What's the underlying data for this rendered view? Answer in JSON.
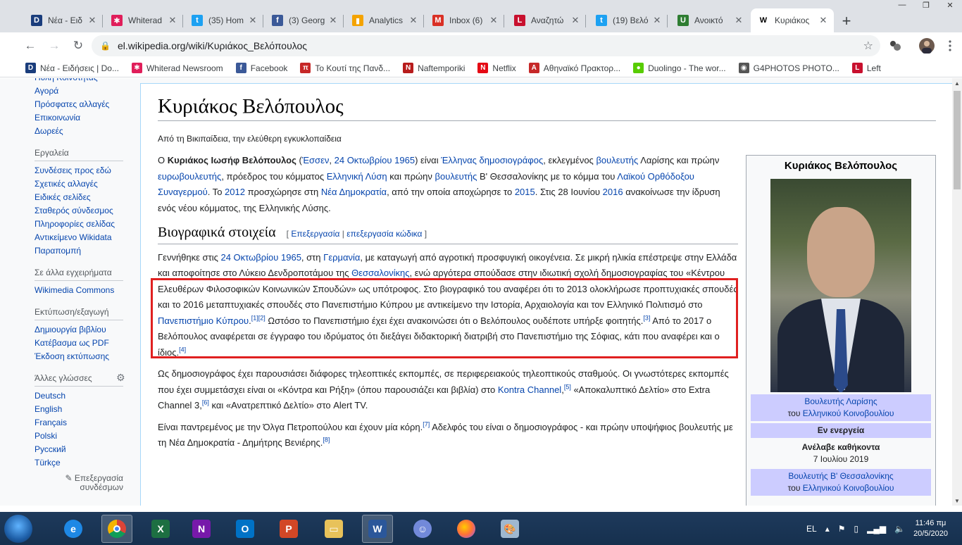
{
  "tabs": [
    {
      "label": "Νέα - Ειδ",
      "favicon": "D",
      "color": "#1a3d7c"
    },
    {
      "label": "Whiterad",
      "favicon": "✱",
      "color": "#e01e5a"
    },
    {
      "label": "(35) Hom",
      "favicon": "t",
      "color": "#1da1f2"
    },
    {
      "label": "(3) Georg",
      "favicon": "f",
      "color": "#3b5998"
    },
    {
      "label": "Analytics",
      "favicon": "▮",
      "color": "#f4a300"
    },
    {
      "label": "Inbox (6)",
      "favicon": "M",
      "color": "#d93025"
    },
    {
      "label": "Αναζητώ",
      "favicon": "L",
      "color": "#c8102e"
    },
    {
      "label": "(19) Βελό",
      "favicon": "t",
      "color": "#1da1f2"
    },
    {
      "label": "Ανοικτό",
      "favicon": "U",
      "color": "#2e7d32"
    },
    {
      "label": "Κυριάκος",
      "favicon": "W",
      "color": "#ffffff"
    }
  ],
  "toolbar": {
    "url": "el.wikipedia.org/wiki/Κυριάκος_Βελόπουλος"
  },
  "bookmarks": [
    {
      "label": "Νέα - Ειδήσεις | Do...",
      "favicon": "D",
      "color": "#1a3d7c"
    },
    {
      "label": "Whiterad Newsroom",
      "favicon": "✱",
      "color": "#e01e5a"
    },
    {
      "label": "Facebook",
      "favicon": "f",
      "color": "#3b5998"
    },
    {
      "label": "Το Κουτί της Πανδ...",
      "favicon": "π",
      "color": "#c62828"
    },
    {
      "label": "Naftemporiki",
      "favicon": "N",
      "color": "#b71c1c"
    },
    {
      "label": "Netflix",
      "favicon": "N",
      "color": "#e50914"
    },
    {
      "label": "Αθηναϊκό Πρακτορ...",
      "favicon": "Α",
      "color": "#c62828"
    },
    {
      "label": "Duolingo - The wor...",
      "favicon": "●",
      "color": "#58cc02"
    },
    {
      "label": "G4PHOTOS PHOTO...",
      "favicon": "◉",
      "color": "#555555"
    },
    {
      "label": "Left",
      "favicon": "L",
      "color": "#c8102e"
    }
  ],
  "sidebar": {
    "nav": [
      "Πύλη Κοινότητας",
      "Αγορά",
      "Πρόσφατες αλλαγές",
      "Επικοινωνία",
      "Δωρεές"
    ],
    "tools_heading": "Εργαλεία",
    "tools": [
      "Συνδέσεις προς εδώ",
      "Σχετικές αλλαγές",
      "Ειδικές σελίδες",
      "Σταθερός σύνδεσμος",
      "Πληροφορίες σελίδας",
      "Αντικείμενο Wikidata",
      "Παραπομπή"
    ],
    "projects_heading": "Σε άλλα εγχειρήματα",
    "projects": [
      "Wikimedia Commons"
    ],
    "print_heading": "Εκτύπωση/εξαγωγή",
    "print": [
      "Δημιουργία βιβλίου",
      "Κατέβασμα ως PDF",
      "Έκδοση εκτύπωσης"
    ],
    "langs_heading": "Άλλες γλώσσες",
    "langs": [
      "Deutsch",
      "English",
      "Français",
      "Polski",
      "Русский",
      "Türkçe"
    ],
    "edit_links": "Επεξεργασία συνδέσμων"
  },
  "article": {
    "title": "Κυριάκος Βελόπουλος",
    "tagline": "Από τη Βικιπαίδεια, την ελεύθερη εγκυκλοπαίδεια",
    "section_title": "Βιογραφικά στοιχεία",
    "section_edit": "Επεξεργασία",
    "section_edit_code": "επεξεργασία κώδικα"
  },
  "infobox": {
    "title": "Κυριάκος Βελόπουλος",
    "office1": "Βουλευτής Λαρίσης",
    "office1_sub_prefix": "του",
    "office1_sub_link": "Ελληνικού Κοινοβουλίου",
    "status": "Εν ενεργεία",
    "took_office_label": "Ανέλαβε καθήκοντα",
    "took_office_date": "7 Ιουλίου 2019",
    "office2": "Βουλευτής Β' Θεσσαλονίκης",
    "office2_sub_prefix": "του",
    "office2_sub_link": "Ελληνικού Κοινοβουλίου"
  },
  "taskbar": {
    "lang": "EL",
    "time": "11:46 πμ",
    "date": "20/5/2020"
  }
}
